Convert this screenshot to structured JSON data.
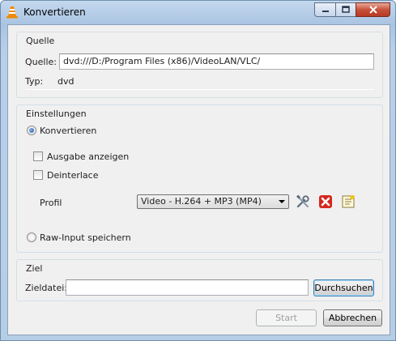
{
  "window": {
    "title": "Konvertieren",
    "icon": "vlc-cone-icon",
    "controls": [
      "minimize-icon",
      "maximize-icon",
      "close-icon"
    ]
  },
  "source_group": {
    "title": "Quelle",
    "source_label": "Quelle:",
    "source_value": "dvd:///D:/Program Files (x86)/VideoLAN/VLC/",
    "type_label": "Typ:",
    "type_value": "dvd"
  },
  "settings_group": {
    "title": "Einstellungen",
    "convert_radio": {
      "label": "Konvertieren",
      "checked": true
    },
    "show_output": {
      "label": "Ausgabe anzeigen",
      "checked": false
    },
    "deinterlace": {
      "label": "Deinterlace",
      "checked": false
    },
    "profile_label": "Profil",
    "profile_selected": "Video - H.264 + MP3 (MP4)",
    "profile_buttons": [
      "tools-icon",
      "delete-icon",
      "new-profile-icon"
    ],
    "raw_radio": {
      "label": "Raw-Input speichern",
      "checked": false
    }
  },
  "target_group": {
    "title": "Ziel",
    "file_label": "Zieldatei:",
    "file_value": "",
    "browse_label": "Durchsuchen"
  },
  "footer": {
    "start_label": "Start",
    "cancel_label": "Abbrechen"
  },
  "colors": {
    "accent": "#3c7fb1",
    "delete_red": "#d4281c",
    "vlc_orange": "#f08a00"
  }
}
